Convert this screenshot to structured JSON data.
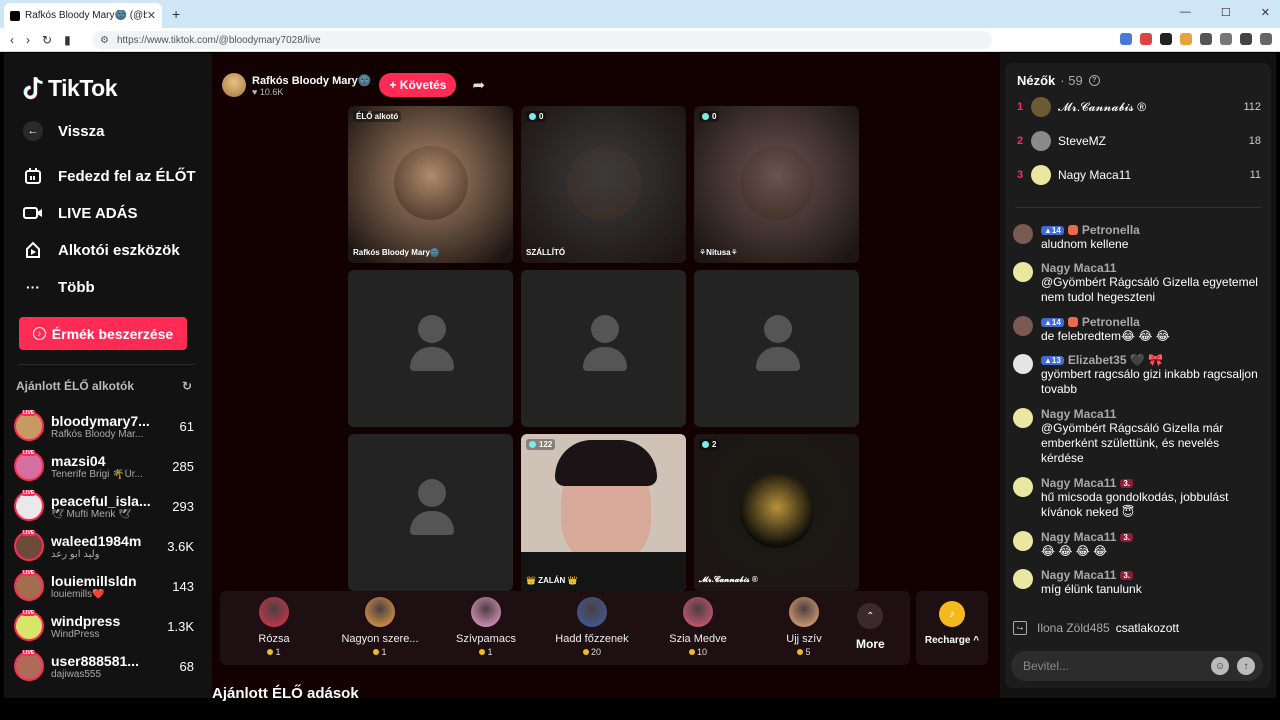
{
  "browser": {
    "tab_title": "Rafkós Bloody Mary🌚 (@blo",
    "url": "https://www.tiktok.com/@bloodymary7028/live",
    "window_controls": [
      "—",
      "☐",
      "✕"
    ]
  },
  "logo": {
    "text": "TikTok"
  },
  "nav": {
    "back": "Vissza",
    "explore_live": "Fedezd fel az ÉLŐT",
    "live_studio": "LIVE ADÁS",
    "creator_tools": "Alkotói eszközök",
    "more": "Több"
  },
  "coins_button": "Érmék beszerzése",
  "recommended": {
    "title": "Ajánlott ÉLŐ alkotók",
    "live_badge": "LIVE",
    "items": [
      {
        "name": "bloodymary7...",
        "sub": "Rafkós Bloody Mar...",
        "count": "61",
        "color": "#c79a63"
      },
      {
        "name": "mazsi04",
        "sub": "Tenerife Brigi 🌴Ür...",
        "count": "285",
        "color": "#d56fa0"
      },
      {
        "name": "peaceful_isla...",
        "sub": "🕊 Mufti Menk 🕊",
        "count": "293",
        "color": "#e9e9e9"
      },
      {
        "name": "waleed1984m",
        "sub": "وليد ابو رعد",
        "count": "3.6K",
        "color": "#6d4a3a"
      },
      {
        "name": "louiemillsldn",
        "sub": "louiemills❤️",
        "count": "143",
        "color": "#a56d4f"
      },
      {
        "name": "windpress",
        "sub": "WindPress",
        "count": "1.3K",
        "color": "#d9e56a"
      },
      {
        "name": "user888581...",
        "sub": "dajiwas555",
        "count": "68",
        "color": "#b06a5a"
      }
    ]
  },
  "host": {
    "name": "Rafkós Bloody Mary🌚",
    "likes": "♥ 10.6K",
    "follow": "+ Követés"
  },
  "grid": {
    "host_badge": "ÉLŐ alkotó",
    "cells": [
      {
        "name": "Rafkós Bloody Mary🌚",
        "count": "",
        "color": "#b08a6a"
      },
      {
        "name": "SZÁLLÍTÓ",
        "count": "0",
        "color": "#3b3b3b"
      },
      {
        "name": "⚘Nitusa⚘",
        "count": "0",
        "color": "#6a5450"
      },
      {
        "name": "",
        "count": "",
        "color": "#232323"
      },
      {
        "name": "",
        "count": "",
        "color": "#232323"
      },
      {
        "name": "",
        "count": "",
        "color": "#232323"
      },
      {
        "name": "",
        "count": "",
        "color": "#232323"
      },
      {
        "name": "👑 ZALÁN 👑",
        "count": "122",
        "color": "#cfc3b8"
      },
      {
        "name": "𝓜𝓻.𝓒𝓪𝓷𝓷𝓪𝓫𝓲𝓼 ®",
        "count": "2",
        "color": "#1a1a14"
      }
    ]
  },
  "gifts": [
    {
      "name": "Rózsa",
      "price": "1",
      "color": "#e2334c"
    },
    {
      "name": "Nagyon szere...",
      "price": "1",
      "color": "#f0a447"
    },
    {
      "name": "Szívpamacs",
      "price": "1",
      "color": "#f4a3d3"
    },
    {
      "name": "Hadd főzzenek",
      "price": "20",
      "color": "#3c5fa8"
    },
    {
      "name": "Szia Medve",
      "price": "10",
      "color": "#e35a7a"
    },
    {
      "name": "Ujj szív",
      "price": "5",
      "color": "#f2b07a"
    }
  ],
  "more_label": "More",
  "recharge_label": "Recharge ^",
  "section_title": "Ajánlott ÉLŐ adások",
  "viewers": {
    "title": "Nézők",
    "count": "· 59",
    "list": [
      {
        "rank": "1",
        "name": "𝓜𝓻.𝓒𝓪𝓷𝓷𝓪𝓫𝓲𝓼 ®",
        "score": "112",
        "color": "#6b5b34"
      },
      {
        "rank": "2",
        "name": "SteveMZ",
        "score": "18",
        "color": "#8a8a8a"
      },
      {
        "rank": "3",
        "name": "Nagy Maca11",
        "score": "11",
        "color": "#e9e7a0"
      }
    ]
  },
  "chat": [
    {
      "user": "Petronella",
      "level": "14",
      "fan": "",
      "heart": true,
      "text": "aludnom kellene",
      "color": "#7a5a50"
    },
    {
      "user": "Nagy Maca11",
      "level": "",
      "fan": "",
      "heart": false,
      "text": "@Gyömbért Rágcsáló Gizella egyetemel nem tudol hegeszteni",
      "color": "#e9e7a0"
    },
    {
      "user": "Petronella",
      "level": "14",
      "fan": "",
      "heart": true,
      "text": "de felebredtem😂 😂 😂",
      "color": "#7a5a50"
    },
    {
      "user": "Elizabet35 🖤 🎀",
      "level": "13",
      "fan": "",
      "heart": false,
      "text": "gyömbert ragcsálo gizi inkabb ragcsaljon tovabb",
      "color": "#e5e5e5"
    },
    {
      "user": "Nagy Maca11",
      "level": "",
      "fan": "",
      "heart": false,
      "text": "@Gyömbért Rágcsáló Gizella már emberként születtünk, és nevelés kérdése",
      "color": "#e9e7a0"
    },
    {
      "user": "Nagy Maca11",
      "level": "",
      "fan": "3.",
      "heart": false,
      "text": "hű micsoda gondolkodás, jobbulást kívánok neked 😇",
      "color": "#e9e7a0"
    },
    {
      "user": "Nagy Maca11",
      "level": "",
      "fan": "3.",
      "heart": false,
      "text": "😂 😂 😂 😂",
      "color": "#e9e7a0"
    },
    {
      "user": "Nagy Maca11",
      "level": "",
      "fan": "3.",
      "heart": false,
      "text": "míg élünk tanulunk",
      "color": "#e9e7a0"
    }
  ],
  "joined": {
    "user": "Ilona Zöld485",
    "text": "csatlakozott"
  },
  "input": {
    "placeholder": "Bevitel..."
  },
  "colors": {
    "accent": "#fe2c55",
    "coin": "#f4b91a"
  }
}
